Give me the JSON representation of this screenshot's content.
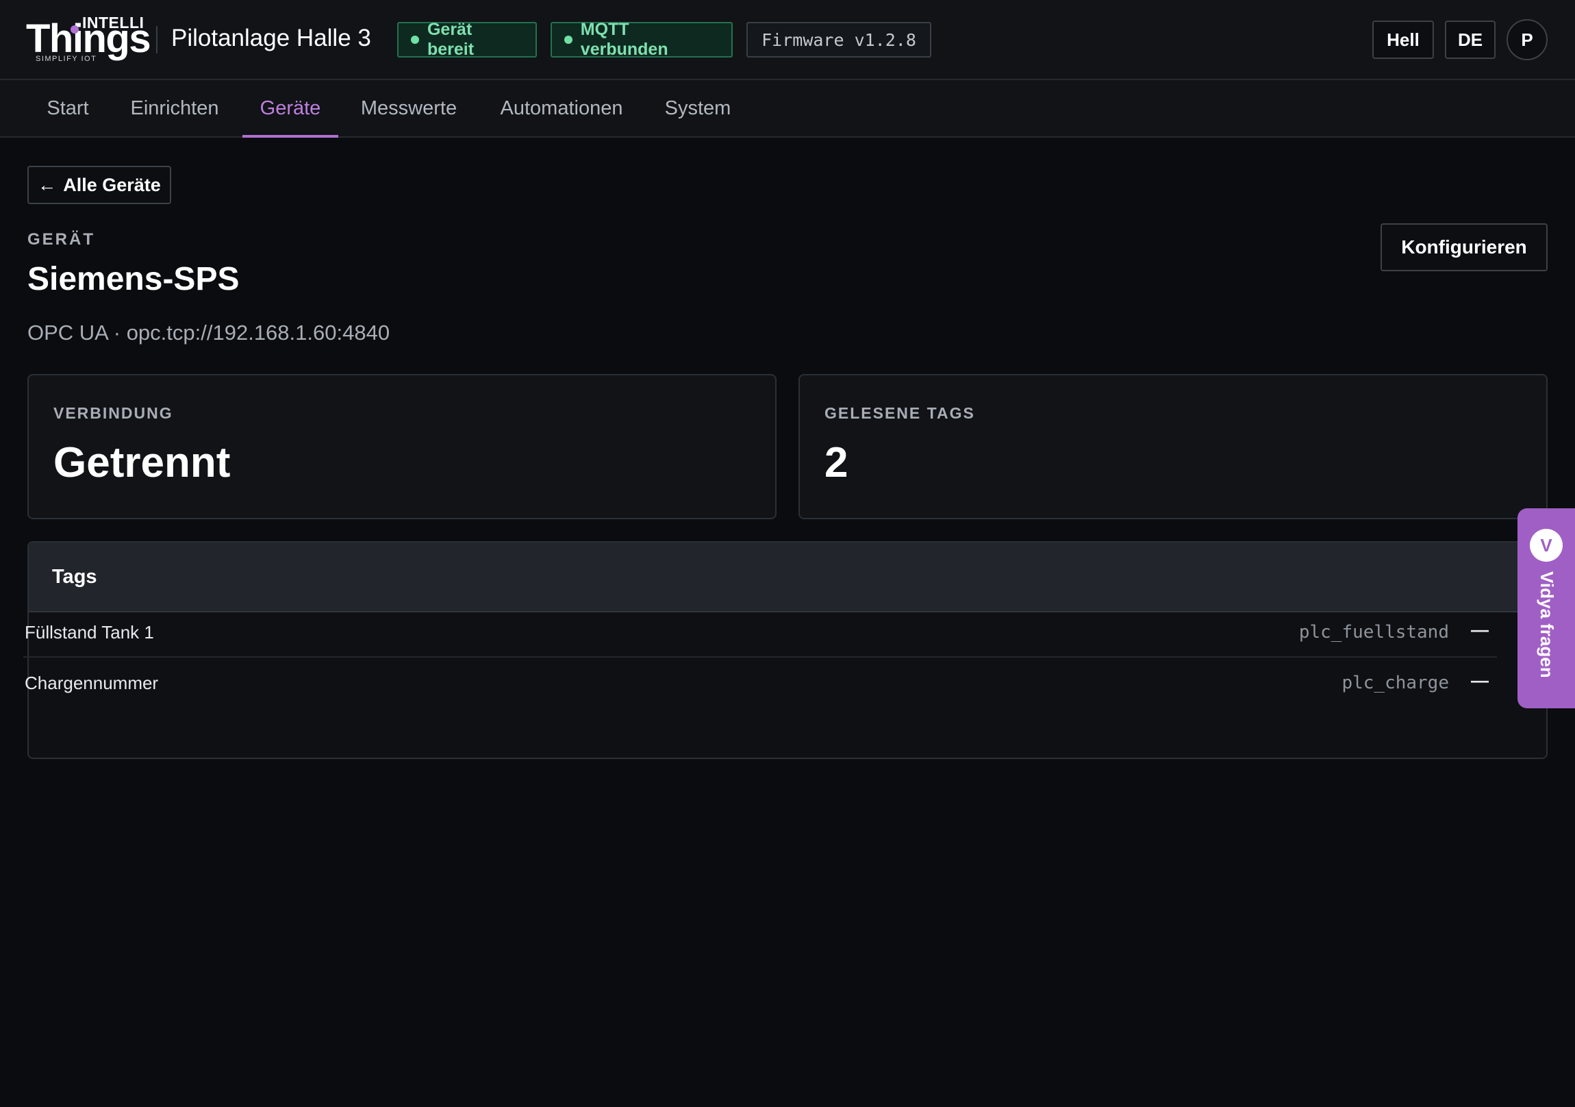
{
  "header": {
    "logo": {
      "top": "INTELLI",
      "main": "Things",
      "tagline": "SIMPLIFY IOT"
    },
    "site_title": "Pilotanlage Halle 3",
    "status_ready": "Gerät bereit",
    "status_mqtt": "MQTT verbunden",
    "firmware": "Firmware v1.2.8",
    "theme_label": "Hell",
    "lang_label": "DE",
    "avatar_initial": "P",
    "status_color": "#6fe1a5"
  },
  "nav": {
    "tabs": [
      {
        "label": "Start"
      },
      {
        "label": "Einrichten"
      },
      {
        "label": "Geräte",
        "active": true
      },
      {
        "label": "Messwerte"
      },
      {
        "label": "Automationen"
      },
      {
        "label": "System"
      }
    ],
    "accent_color": "#b06fd1"
  },
  "main": {
    "back_label": "Alle Geräte",
    "eyebrow": "GERÄT",
    "device_name": "Siemens-SPS",
    "device_subtitle": "OPC UA · opc.tcp://192.168.1.60:4840",
    "configure_label": "Konfigurieren",
    "stats": [
      {
        "label": "VERBINDUNG",
        "value": "Getrennt"
      },
      {
        "label": "GELESENE TAGS",
        "value": "2"
      }
    ],
    "tags_panel": {
      "title": "Tags",
      "rows": [
        {
          "name": "Füllstand Tank 1",
          "id": "plc_fuellstand",
          "value": "—"
        },
        {
          "name": "Chargennummer",
          "id": "plc_charge",
          "value": "—"
        }
      ]
    }
  },
  "assistant": {
    "badge": "V",
    "label": "Vidya fragen",
    "color": "#a05fc5"
  }
}
